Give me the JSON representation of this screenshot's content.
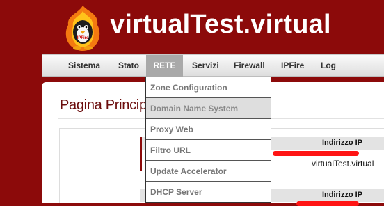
{
  "header": {
    "logo_label": "IPFire",
    "site_title": "virtualTest.virtual"
  },
  "nav": {
    "items": [
      {
        "label": "Sistema"
      },
      {
        "label": "Stato"
      },
      {
        "label": "RETE"
      },
      {
        "label": "Servizi"
      },
      {
        "label": "Firewall"
      },
      {
        "label": "IPFire"
      },
      {
        "label": "Log"
      }
    ],
    "active": "RETE"
  },
  "dropdown": {
    "items": [
      {
        "label": "Zone Configuration"
      },
      {
        "label": "Domain Name System"
      },
      {
        "label": "Proxy Web"
      },
      {
        "label": "Filtro URL"
      },
      {
        "label": "Update Accelerator"
      },
      {
        "label": "DHCP Server"
      }
    ]
  },
  "main": {
    "page_title": "Pagina Principale",
    "table_header_1": "Indirizzo IP",
    "hostname": "virtualTest.virtual",
    "table_header_2": "Indirizzo IP"
  },
  "colors": {
    "brand_red": "#8c0a0a",
    "title_red": "#6b0d0d",
    "redaction": "#ff1414",
    "nav_active": "#a9a9a9"
  }
}
